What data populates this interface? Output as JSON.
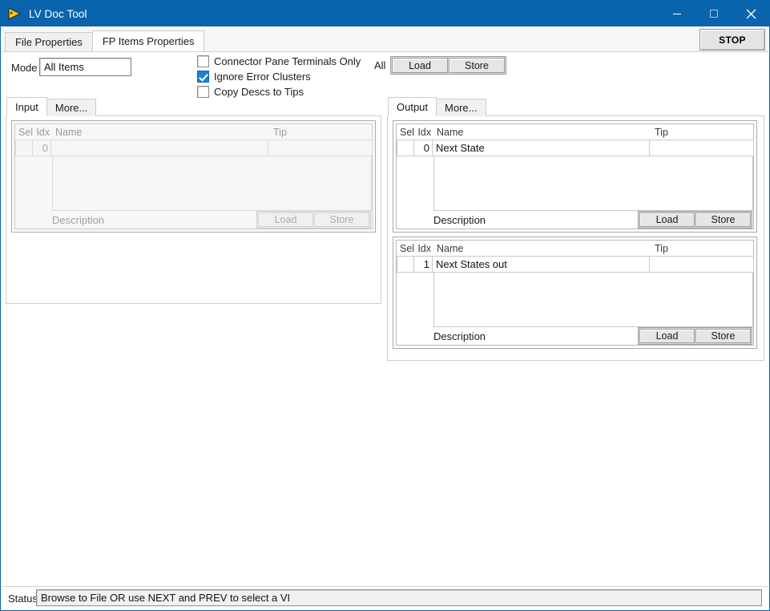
{
  "window": {
    "title": "LV Doc Tool",
    "icon": "labview-run-arrow-icon",
    "minimize": "minimize-icon",
    "maximize": "maximize-icon",
    "close": "close-icon",
    "titlebar_color": "#0a64ad"
  },
  "toolbar": {
    "stop_label": "STOP"
  },
  "main_tabs": [
    {
      "label": "File Properties",
      "active": false
    },
    {
      "label": "FP Items Properties",
      "active": true
    }
  ],
  "mode": {
    "label": "Mode",
    "value": "All Items"
  },
  "checkboxes": [
    {
      "label": "Connector Pane Terminals Only",
      "checked": false
    },
    {
      "label": "Ignore Error Clusters",
      "checked": true
    },
    {
      "label": "Copy Descs to Tips",
      "checked": false
    }
  ],
  "all_group": {
    "label": "All",
    "load_label": "Load",
    "store_label": "Store"
  },
  "input_panel": {
    "tabs": [
      {
        "label": "Input",
        "active": true
      },
      {
        "label": "More...",
        "active": false
      }
    ],
    "enabled": false,
    "groups": [
      {
        "headers": {
          "sel": "Sel",
          "idx": "Idx",
          "name": "Name",
          "tip": "Tip"
        },
        "row": {
          "sel": "",
          "idx": "0",
          "name": "",
          "tip": ""
        },
        "description_label": "Description",
        "load_label": "Load",
        "store_label": "Store"
      }
    ]
  },
  "output_panel": {
    "tabs": [
      {
        "label": "Output",
        "active": true
      },
      {
        "label": "More...",
        "active": false
      }
    ],
    "enabled": true,
    "groups": [
      {
        "headers": {
          "sel": "Sel",
          "idx": "Idx",
          "name": "Name",
          "tip": "Tip"
        },
        "row": {
          "sel": "",
          "idx": "0",
          "name": "Next State",
          "tip": ""
        },
        "description_label": "Description",
        "load_label": "Load",
        "store_label": "Store"
      },
      {
        "headers": {
          "sel": "Sel",
          "idx": "Idx",
          "name": "Name",
          "tip": "Tip"
        },
        "row": {
          "sel": "",
          "idx": "1",
          "name": "Next States out",
          "tip": ""
        },
        "description_label": "Description",
        "load_label": "Load",
        "store_label": "Store"
      }
    ]
  },
  "status": {
    "label": "Status",
    "message": "Browse to File OR use NEXT and PREV to select a VI"
  },
  "colors": {
    "accent": "#0a64ad",
    "checkbox_checked": "#1d7fd4"
  }
}
